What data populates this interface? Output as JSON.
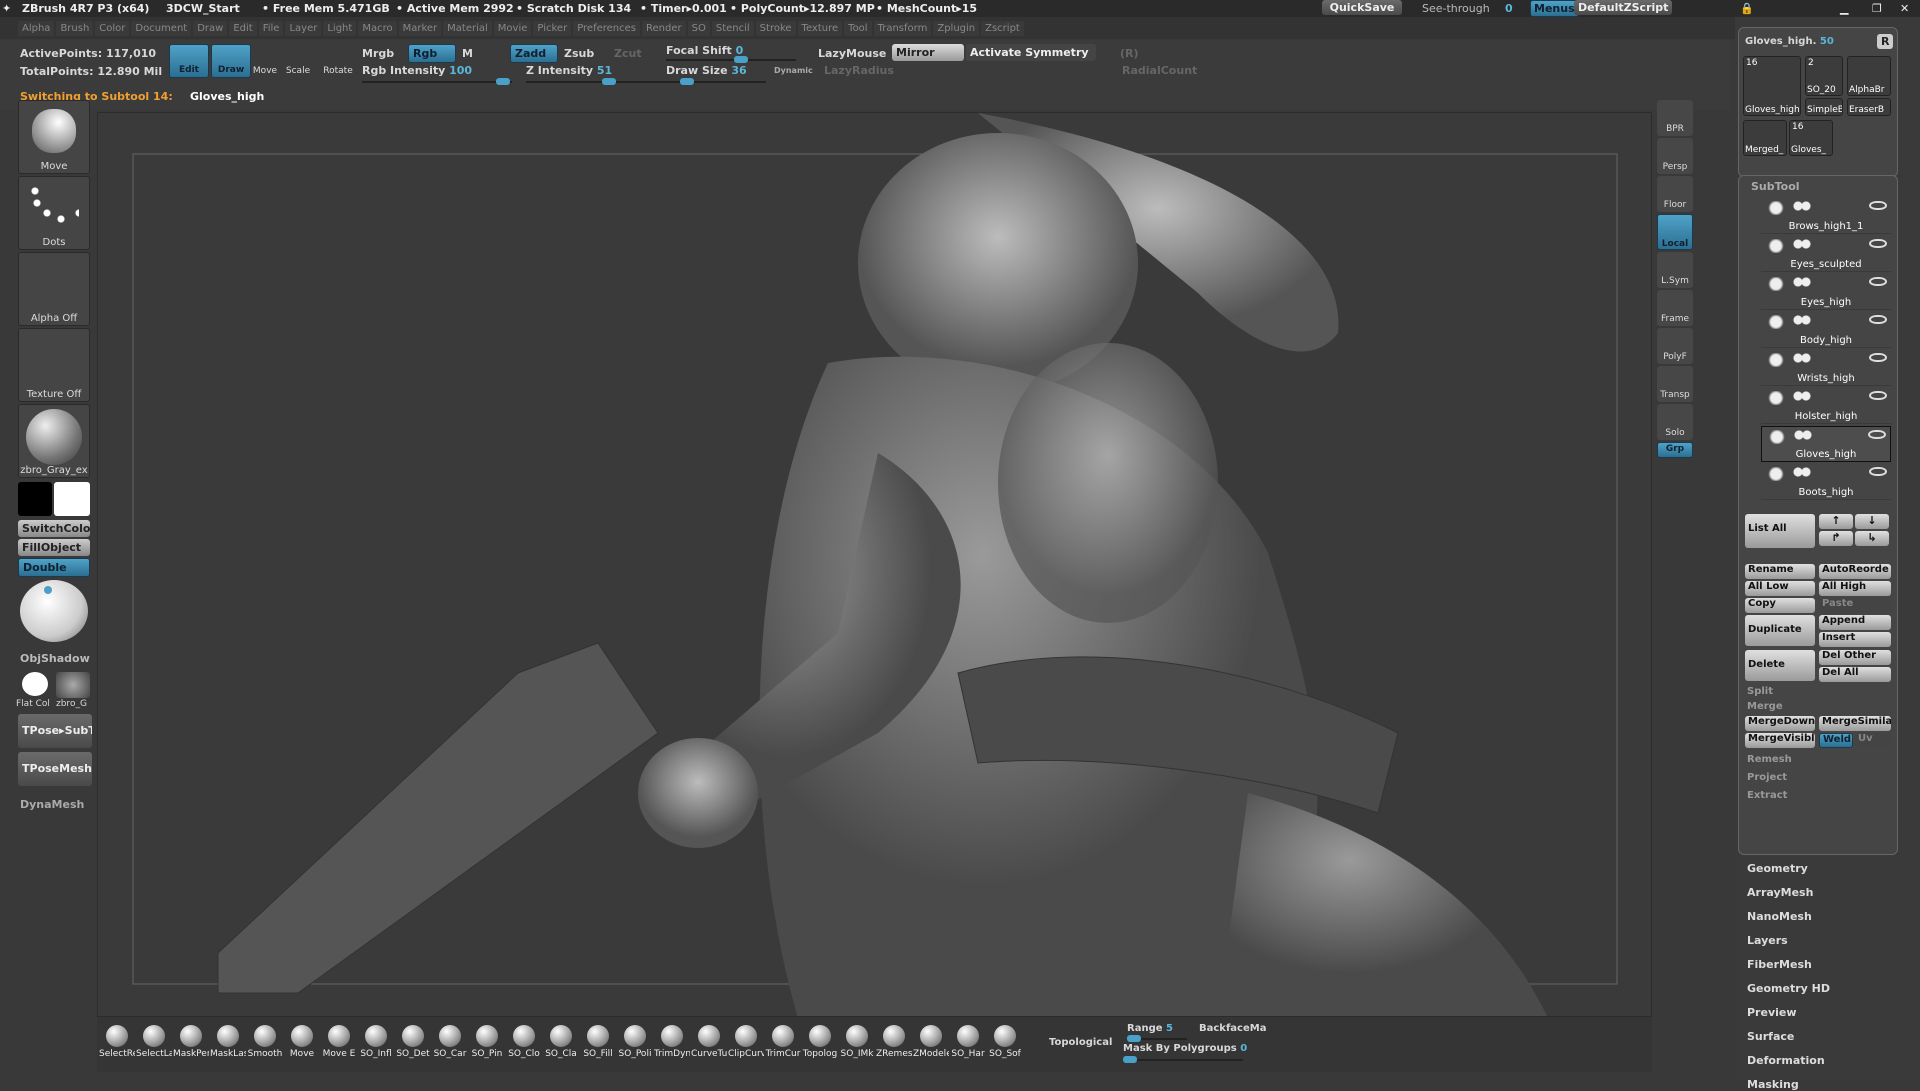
{
  "titlebar": {
    "app": "ZBrush 4R7 P3 (x64)",
    "doc": "3DCW_Start",
    "free_mem": "• Free Mem 5.471GB",
    "active_mem": "• Active Mem 2992",
    "scratch": "• Scratch Disk 134",
    "timer": "• Timer▸0.001",
    "polycount": "• PolyCount▸12.897 MP",
    "meshcount": "• MeshCount▸15",
    "quicksave": "QuickSave",
    "see_through_label": "See-through",
    "see_through_value": "0",
    "menus": "Menus",
    "script": "DefaultZScript"
  },
  "menubar": [
    "Alpha",
    "Brush",
    "Color",
    "Document",
    "Draw",
    "Edit",
    "File",
    "Layer",
    "Light",
    "Macro",
    "Marker",
    "Material",
    "Movie",
    "Picker",
    "Preferences",
    "Render",
    "SO",
    "Stencil",
    "Stroke",
    "Texture",
    "Tool",
    "Transform",
    "Zplugin",
    "Zscript"
  ],
  "topshelf": {
    "active_points_label": "ActivePoints:",
    "active_points": "117,010",
    "total_points_label": "TotalPoints:",
    "total_points": "12.890 Mil",
    "edit": "Edit",
    "draw": "Draw",
    "move": "Move",
    "scale": "Scale",
    "rotate": "Rotate",
    "mrgb": "Mrgb",
    "rgb": "Rgb",
    "m": "M",
    "zadd": "Zadd",
    "zsub": "Zsub",
    "zcut": "Zcut",
    "rgb_intensity_label": "Rgb Intensity",
    "rgb_intensity": "100",
    "z_intensity_label": "Z Intensity",
    "z_intensity": "51",
    "focal_shift_label": "Focal Shift",
    "focal_shift": "0",
    "draw_size_label": "Draw Size",
    "draw_size": "36",
    "dynamic": "Dynamic",
    "lazymouse": "LazyMouse",
    "lazyradius": "LazyRadius",
    "mirror": "Mirror",
    "activate_symmetry": "Activate Symmetry",
    "r": "(R)",
    "radialcount": "RadialCount",
    "notice_label": "Switching to Subtool 14:",
    "notice_value": "Gloves_high"
  },
  "leftshelf": {
    "brush": "Move",
    "stroke": "Dots",
    "alpha": "Alpha  Off",
    "texture": "Texture  Off",
    "material": "zbro_Gray_ex",
    "switchcolor": "SwitchColor",
    "fillobject": "FillObject",
    "double": "Double",
    "objshadow": "ObjShadow",
    "flat": "Flat  Col",
    "zbro": "zbro_G",
    "tpose": "TPose▸SubT",
    "tposemesh": "TPoseMesh",
    "dynamesh": "DynaMesh"
  },
  "rightshelf": [
    "BPR",
    "Persp",
    "Floor",
    "Local",
    "L.Sym",
    "Frame",
    "PolyF",
    "Transp",
    "Solo",
    "Grp"
  ],
  "lightbox": {
    "tool_name": "Gloves_high.",
    "tool_value": "50",
    "r": "R",
    "thumbs": [
      {
        "count": "16",
        "name": "Gloves_high"
      },
      {
        "count": "2",
        "name": "SO_20"
      },
      {
        "name": "AlphaBr"
      },
      {
        "name": "SimpleB"
      },
      {
        "name": "EraserB"
      },
      {
        "name": "Merged_"
      },
      {
        "count": "16",
        "name": "Gloves_"
      }
    ]
  },
  "subtool": {
    "title": "SubTool",
    "items": [
      "Brows_high1_1",
      "Eyes_sculpted",
      "Eyes_high",
      "Body_high",
      "Wrists_high",
      "Holster_high",
      "Gloves_high",
      "Boots_high"
    ],
    "selected": "Gloves_high",
    "buttons": {
      "list_all": "List All",
      "rename": "Rename",
      "autoreorder": "AutoReorde",
      "all_low": "All Low",
      "all_high": "All High",
      "copy": "Copy",
      "paste": "Paste",
      "duplicate": "Duplicate",
      "append": "Append",
      "insert": "Insert",
      "delete": "Delete",
      "del_other": "Del Other",
      "del_all": "Del All",
      "split": "Split",
      "merge": "Merge",
      "mergedown": "MergeDown",
      "mergesimilar": "MergeSimilar",
      "mergevisible": "MergeVisible",
      "weld": "Weld",
      "uv": "Uv",
      "remesh": "Remesh",
      "project": "Project",
      "extract": "Extract"
    }
  },
  "tool_menu": [
    "Geometry",
    "ArrayMesh",
    "NanoMesh",
    "Layers",
    "FiberMesh",
    "Geometry HD",
    "Preview",
    "Surface",
    "Deformation",
    "Masking"
  ],
  "bottomshelf": {
    "brushes": [
      "SelectRe",
      "SelectLa",
      "MaskPen",
      "MaskLas",
      "Smooth",
      "Move",
      "Move E",
      "SO_Infl",
      "SO_Det",
      "SO_Car",
      "SO_Pin",
      "SO_Clo",
      "SO_Cla",
      "SO_Fill",
      "SO_Poli",
      "TrimDyn",
      "CurveTu",
      "ClipCurv",
      "TrimCur",
      "Topolog",
      "SO_IMk",
      "ZRemesl",
      "ZModele",
      "SO_Har",
      "SO_Sof"
    ],
    "topological": "Topological",
    "range_label": "Range",
    "range": "5",
    "backface": "BackfaceMa",
    "mask_polygroups_label": "Mask By Polygroups",
    "mask_polygroups": "0"
  },
  "colors": {
    "accent": "#4aa0c8",
    "notice": "#f0a030",
    "bg": "#393939"
  }
}
